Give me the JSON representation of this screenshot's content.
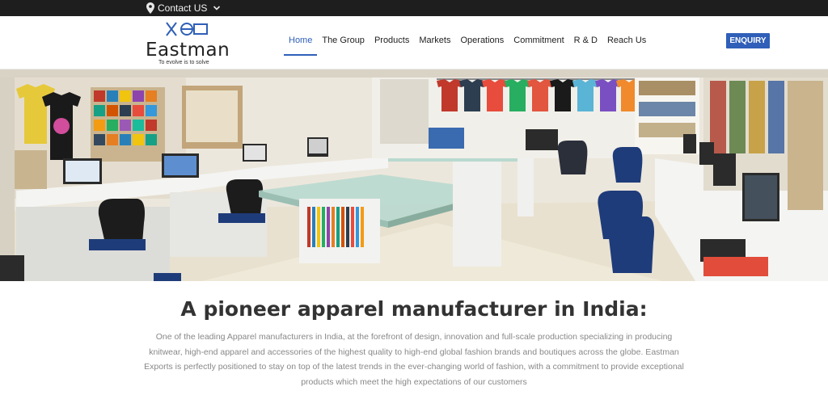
{
  "topbar": {
    "contact_label": "Contact US",
    "icon": "location-pin-icon",
    "background": "#1e1e1e"
  },
  "brand": {
    "name": "Eastman",
    "tagline": "To evolve is to solve",
    "mark_color": "#2f5fb8"
  },
  "nav": {
    "items": [
      {
        "label": "Home",
        "active": true
      },
      {
        "label": "The Group",
        "active": false
      },
      {
        "label": "Products",
        "active": false
      },
      {
        "label": "Markets",
        "active": false
      },
      {
        "label": "Operations",
        "active": false
      },
      {
        "label": "Commitment",
        "active": false
      },
      {
        "label": "R & D",
        "active": false
      },
      {
        "label": "Reach Us",
        "active": false
      }
    ],
    "accent": "#2f5fb8"
  },
  "enquiry_label": "ENQUIRY",
  "hero": {
    "description": "Panoramic photo of a design studio with computer workstations, glass display tables and t-shirts on hangers"
  },
  "intro": {
    "title": "A pioneer apparel manufacturer in India:",
    "body": "One of the leading Apparel manufacturers in India, at the forefront of design, innovation and full-scale production specializing in producing knitwear, high-end apparel and accessories of the highest quality to high-end global fashion brands and boutiques across the globe. Eastman Exports is perfectly positioned to stay on top of the latest trends in the ever-changing world of fashion, with a commitment to provide exceptional products which meet the high expectations of our customers"
  }
}
